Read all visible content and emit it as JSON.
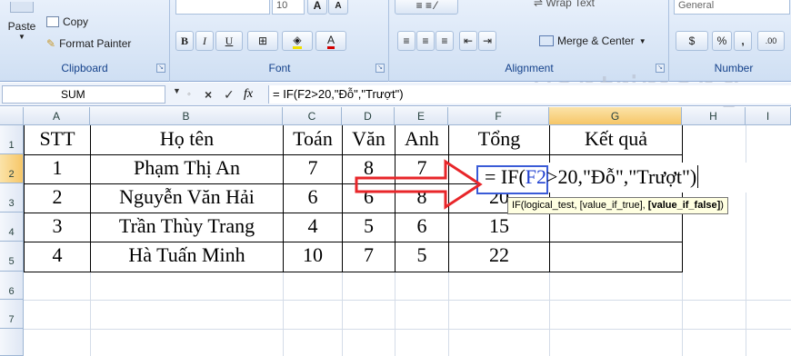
{
  "ribbon": {
    "clipboard": {
      "paste": "Paste",
      "copy": "Copy",
      "format_painter": "Format Painter",
      "label": "Clipboard"
    },
    "font": {
      "size_value": "10",
      "grow": "A",
      "shrink": "A",
      "bold": "B",
      "italic": "I",
      "underline": "U",
      "font_color": "A",
      "label": "Font"
    },
    "alignment": {
      "wrap_text": "Wrap Text",
      "merge_center": "Merge & Center",
      "label": "Alignment"
    },
    "number": {
      "format_value": "General",
      "currency": "$",
      "percent": "%",
      "comma": ",",
      "increase_decimal": ".00",
      "label": "Number"
    }
  },
  "formula_bar": {
    "name_box": "SUM",
    "cancel_icon": "×",
    "enter_icon": "✓",
    "fx": "fx",
    "formula": "= IF(F2>20,\"Đỗ\",\"Trượt\")"
  },
  "grid": {
    "columns": [
      "A",
      "B",
      "C",
      "D",
      "E",
      "F",
      "G",
      "H",
      "I"
    ],
    "rows": [
      "1",
      "2",
      "3",
      "4",
      "5",
      "6",
      "7"
    ],
    "header_row": [
      "STT",
      "Họ tên",
      "Toán",
      "Văn",
      "Anh",
      "Tổng",
      "Kết quả"
    ],
    "data": [
      [
        "1",
        "Phạm Thị An",
        "7",
        "8",
        "7",
        ""
      ],
      [
        "2",
        "Nguyễn Văn Hải",
        "6",
        "6",
        "8",
        "20"
      ],
      [
        "3",
        "Trần Thùy Trang",
        "4",
        "5",
        "6",
        "15"
      ],
      [
        "4",
        "Hà Tuấn Minh",
        "10",
        "7",
        "5",
        "22"
      ]
    ]
  },
  "editing": {
    "prefix": "= IF(",
    "ref": "F2",
    "suffix": ">20,\"Đỗ\",\"Trượt\")"
  },
  "tooltip": {
    "prefix": "IF(logical_test, [value_if_true], ",
    "active": "[value_if_false]",
    "suffix": ")"
  },
  "watermark": "uantrimang",
  "colors": {
    "accent": "#3a5bd7",
    "arrow": "#e8262a",
    "ribbon": "#dbe6f5"
  }
}
